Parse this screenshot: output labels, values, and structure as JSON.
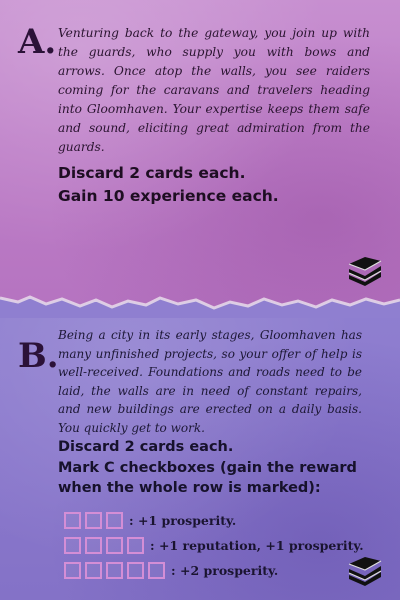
{
  "option_a": {
    "letter": "A.",
    "story": "Venturing back to the gateway, you join up with the guards, who supply you with bows and arrows. Once atop the walls, you see raiders coming for the caravans and travelers heading into Gloomhaven. Your expertise keeps them safe and sound, eliciting great admiration from the guards.",
    "rewards": [
      "Discard 2 cards each.",
      "Gain 10 experience each."
    ],
    "icon": "card-deck-icon"
  },
  "option_b": {
    "letter": "B.",
    "story": "Being a city in its early stages, Gloomhaven has many unfinished projects, so your offer of help is well-received. Foundations and roads need to be laid, the walls are in need of constant repairs, and new buildings are erected on a daily basis. You quickly get to work.",
    "rewards": [
      "Discard 2 cards each.",
      "Mark C checkboxes (gain the reward when the whole row is marked):"
    ],
    "checkbox_rows": [
      {
        "boxes": 3,
        "label": ": +1 prosperity."
      },
      {
        "boxes": 4,
        "label": ": +1 reputation, +1 prosperity."
      },
      {
        "boxes": 5,
        "label": ": +2 prosperity."
      }
    ],
    "icon": "card-deck-icon"
  },
  "colors": {
    "option_a_bg": "#be7fc8",
    "option_b_bg": "#8a78cc",
    "checkbox_border": "#d48ed6",
    "text_dark": "#1e0e22"
  }
}
